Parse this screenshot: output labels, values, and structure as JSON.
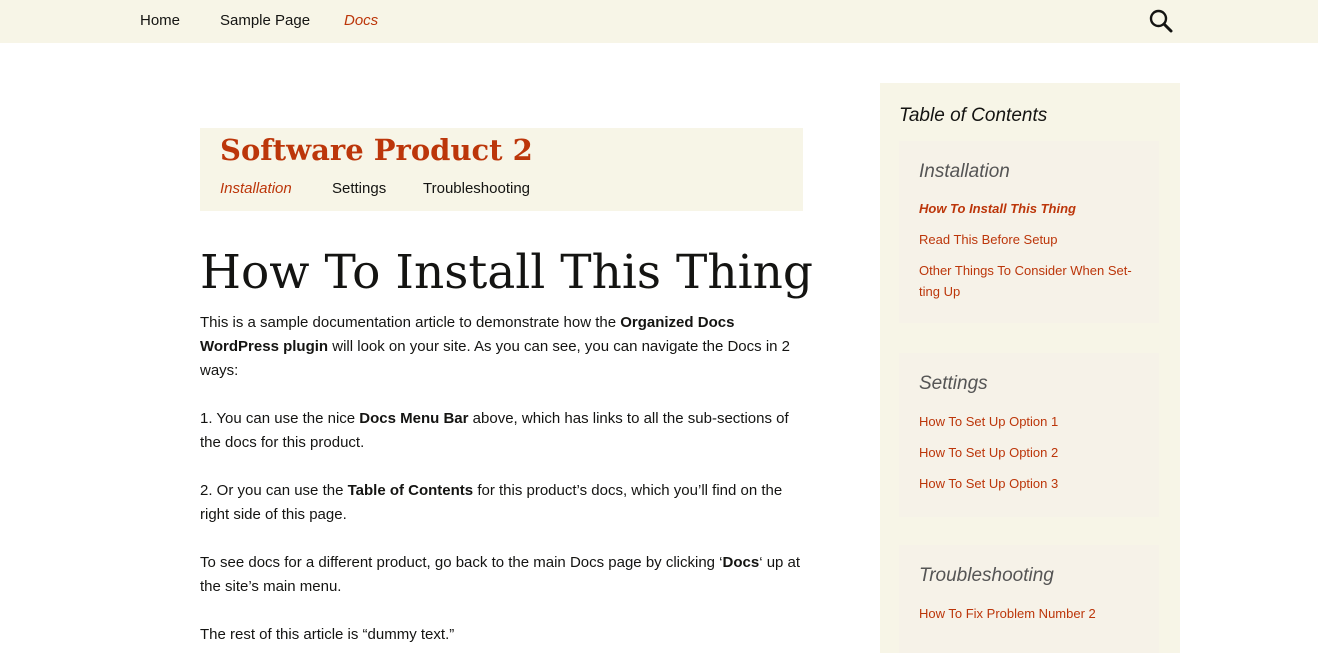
{
  "nav": {
    "home": "Home",
    "sample_page": "Sample Page",
    "docs": "Docs"
  },
  "icons": {
    "search": "search-icon"
  },
  "colors": {
    "accent": "#bc360a",
    "nav_bg": "#f7f5e7",
    "text": "#141412"
  },
  "docs_header": {
    "product_title": "Software Product 2",
    "tabs": [
      "Installation",
      "Settings",
      "Troubleshooting"
    ]
  },
  "article": {
    "title": "How To Install This Thing",
    "p1": {
      "a": "This is a sample documentation article to demonstrate how the ",
      "b": "Organized Docs WordPress plugin",
      "c": " will look on your site. As you can see, you can navigate the Docs in 2 ways:"
    },
    "p2": {
      "a": "1. You can use the nice ",
      "b": "Docs Menu Bar",
      "c": " above, which has links to all the sub-sections of the docs for this product."
    },
    "p3": {
      "a": "2. Or you can use the ",
      "b": "Table of Contents",
      "c": " for this product’s docs, which you’ll find on the right side of this page."
    },
    "p4": {
      "a": "To see docs for a different product, go back to the main Docs page by clicking ‘",
      "b": "Docs",
      "c": "‘ up at the site’s main menu."
    },
    "p5": "The rest of this article is “dummy text.”"
  },
  "toc": {
    "title": "Table of Contents",
    "sections": [
      {
        "title": "Installation",
        "links": [
          "How To Install This Thing",
          "Read This Before Setup",
          "Other Things To Consider When Set-ting Up"
        ]
      },
      {
        "title": "Settings",
        "links": [
          "How To Set Up Option 1",
          "How To Set Up Option 2",
          "How To Set Up Option 3"
        ]
      },
      {
        "title": "Troubleshooting",
        "links": [
          "How To Fix Problem Number 2"
        ]
      }
    ]
  }
}
